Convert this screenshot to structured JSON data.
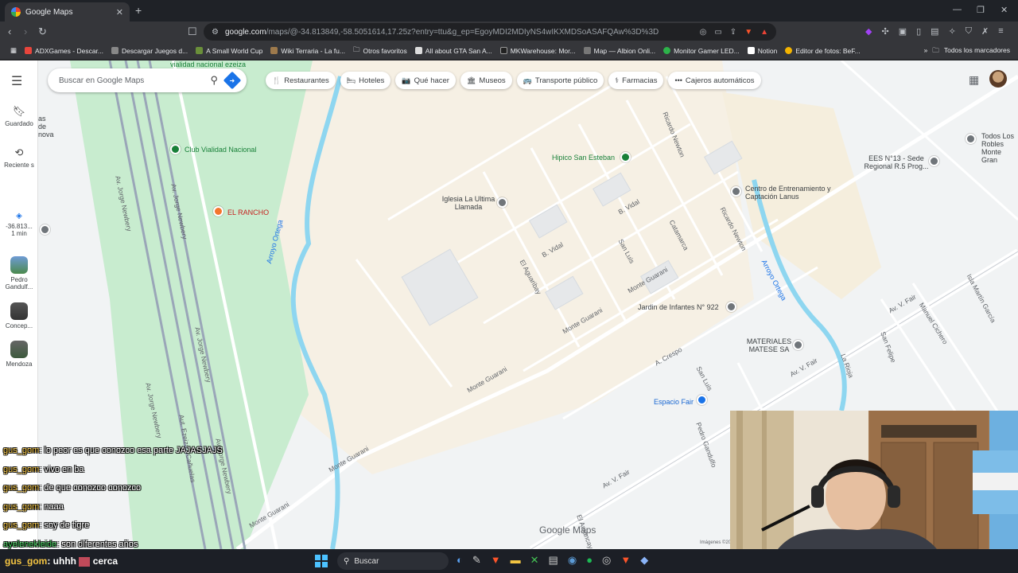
{
  "browser": {
    "tab_title": "Google Maps",
    "tab_close": "✕",
    "new_tab": "+",
    "url_host": "google.com",
    "url_path": "/maps/@-34.813849,-58.5051614,17.25z?entry=ttu&g_ep=EgoyMDI2MDIyNS4wIKXMDSoASAFQAw%3D%3D",
    "bookmarks": [
      "ADXGames - Descar...",
      "Descargar Juegos d...",
      "A Small World Cup",
      "Wiki Terraria - La fu...",
      "Otros favoritos",
      "All about GTA San A...",
      "MKWarehouse: Mor...",
      "Map — Albion Onli...",
      "Monitor Gamer LED...",
      "Notion",
      "Editor de fotos: BeF..."
    ],
    "bookmarks_right": "Todos los marcadores"
  },
  "maps": {
    "search_placeholder": "Buscar en Google Maps",
    "chips": [
      {
        "icon": "🍴",
        "label": "Restaurantes"
      },
      {
        "icon": "🛏",
        "label": "Hoteles"
      },
      {
        "icon": "📷",
        "label": "Qué hacer"
      },
      {
        "icon": "🏛",
        "label": "Museos"
      },
      {
        "icon": "🚌",
        "label": "Transporte público"
      },
      {
        "icon": "⚕",
        "label": "Farmacias"
      },
      {
        "icon": "•••",
        "label": "Cajeros automáticos"
      }
    ],
    "rail": {
      "saved": "Guardado",
      "recent": "Reciente s",
      "coord": "-36.813...",
      "coord_time": "1 min",
      "pedro": "Pedro Gandulf...",
      "concep": "Concep...",
      "mendoza": "Mendoza"
    },
    "places": {
      "club": "Club Vialidad Nacional",
      "rancho": "EL RANCHO",
      "hipico": "Hipico San Esteban",
      "iglesia": "Iglesia La Ultima Llamada",
      "centro": "Centro de Entrenamiento y Captación Lanus",
      "ees": "EES N°13 - Sede Regional R.5 Prog...",
      "jardin": "Jardin de Infantes N° 922",
      "materiales": "MATERIALES MATESE SA",
      "espacio": "Espacio Fair",
      "robles": "Todos Los Robles Monte Gran",
      "vialidad": "vialidad nacional ezeiza",
      "hova": "as de nova"
    },
    "streets": {
      "jorge1": "Av. Jorge Newbery",
      "jorge2": "Av. Jorge Newbery",
      "jorge3": "Av. Jorge Newbery",
      "jorge4": "Av. Jorge Newbery",
      "jorge5": "Av. Jorge Newbery",
      "monte1": "Monte Guarani",
      "monte2": "Monte Guarani",
      "monte3": "Monte Guarani",
      "monte4": "Monte Guarani",
      "monte5": "Monte Guarani",
      "bvidal1": "B. Vidal",
      "bvidal2": "B. Vidal",
      "sanluis1": "San Luis",
      "sanluis2": "San Luis",
      "catamarca": "Catamarca",
      "ricardo1": "Ricardo Newton",
      "ricardo2": "Ricardo Newton",
      "elaguaribay": "El Aguaribay",
      "acrespo": "A. Crespo",
      "avfair1": "Av. V. Fair",
      "avfair2": "Av. V. Fair",
      "avfair3": "Av. V. Fair",
      "manuel": "Manuel Cichero",
      "islamartin": "Isla Martín García",
      "sanfelipe": "San Felipe",
      "larioja": "La Rioja",
      "pedrog": "Pedro Gandulfo",
      "elamancay": "El Amancay",
      "autopista": "Aut. Ezeiza - Cañuelas"
    },
    "rivers": {
      "ortega1": "Arroyo Ortega",
      "ortega2": "Arroyo Ortega"
    },
    "logo": "Google Maps",
    "credit": "Imágenes ©2026 , Datos del"
  },
  "chat": [
    {
      "user": "gus_gom",
      "text": ": lo peor es que conozco esa parte JAJASJAJS"
    },
    {
      "user": "gus_gom",
      "text": ": vivo en ba"
    },
    {
      "user": "gus_gom",
      "text": ": de que conozco conozco"
    },
    {
      "user": "gus_gom",
      "text": ": naaa"
    },
    {
      "user": "gus_gom",
      "text": ": soy de tigre"
    },
    {
      "user": "ayelenekleide",
      "text": ": son diferentes años"
    }
  ],
  "taskbar": {
    "chat_user": "gus_gom",
    "chat_text": ": uhhh",
    "chat_text2": "cerca",
    "search": "Buscar"
  },
  "colors": {
    "park": "#c8eccf",
    "sand": "#f6eedc",
    "river": "#8ed6f0",
    "road": "#ffffff",
    "highway": "#9aa6b8"
  }
}
